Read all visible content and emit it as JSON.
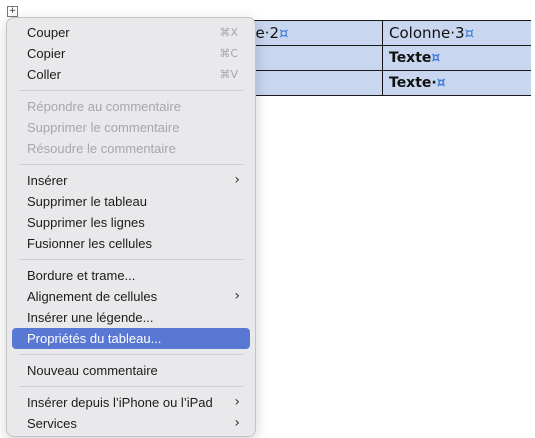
{
  "table": {
    "rows": [
      [
        "ne·2",
        "Colonne·3"
      ],
      [
        "",
        "Texte"
      ],
      [
        "",
        "Texte·"
      ]
    ]
  },
  "menu": {
    "group1": [
      {
        "label": "Couper",
        "shortcut": "⌘X"
      },
      {
        "label": "Copier",
        "shortcut": "⌘C"
      },
      {
        "label": "Coller",
        "shortcut": "⌘V"
      }
    ],
    "group2": [
      {
        "label": "Répondre au commentaire"
      },
      {
        "label": "Supprimer le commentaire"
      },
      {
        "label": "Résoudre le commentaire"
      }
    ],
    "group3": [
      {
        "label": "Insérer"
      },
      {
        "label": "Supprimer le tableau"
      },
      {
        "label": "Supprimer les lignes"
      },
      {
        "label": "Fusionner les cellules"
      }
    ],
    "group4": [
      {
        "label": "Bordure et trame..."
      },
      {
        "label": "Alignement de cellules"
      },
      {
        "label": "Insérer une légende..."
      },
      {
        "label": "Propriétés du tableau..."
      }
    ],
    "group5": [
      {
        "label": "Nouveau commentaire"
      }
    ],
    "group6": [
      {
        "label": "Insérer depuis l’iPhone ou l’iPad"
      },
      {
        "label": "Services"
      }
    ],
    "submenu_glyph": "›",
    "cell_mark": "¤",
    "move_handle_glyph": "+"
  },
  "colors": {
    "menu_bg": "#e9e9eb",
    "selected": "#5978d4",
    "table_cell": "#c9d6ef",
    "disabled_text": "#a7a7aa"
  }
}
